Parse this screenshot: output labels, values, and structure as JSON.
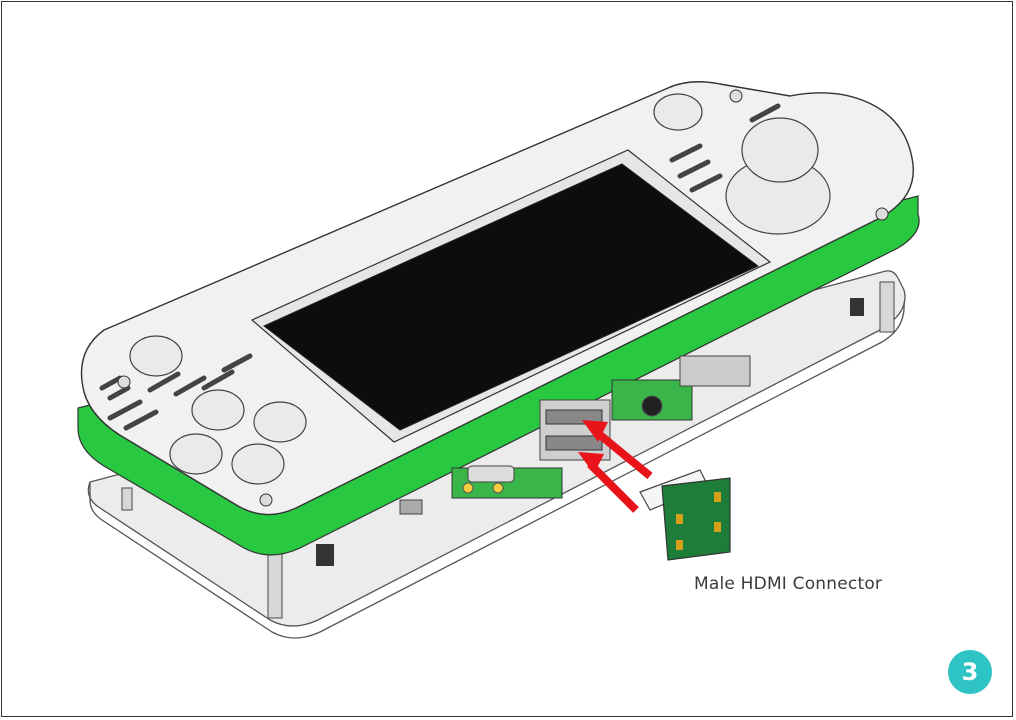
{
  "annotation": {
    "connector_label": "Male HDMI Connector"
  },
  "step": {
    "number": "3",
    "color": "#2ec4c6"
  },
  "colors": {
    "pcb_green": "#28c840",
    "arrow_red": "#e8141a",
    "screen": "#0d0d0d",
    "body_white": "#f1f1f1"
  }
}
